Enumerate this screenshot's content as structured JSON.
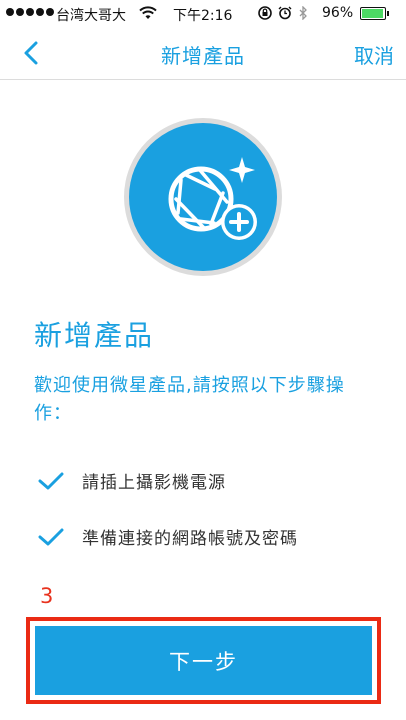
{
  "status_bar": {
    "carrier": "台湾大哥大",
    "time": "下午2:16",
    "battery_percent": "96%",
    "battery_level": 0.96
  },
  "nav": {
    "title": "新增產品",
    "cancel_label": "取消",
    "back_icon": "chevron-left-icon"
  },
  "hero": {
    "icon": "camera-shutter-add-icon",
    "color": "#1aa0e0"
  },
  "content": {
    "heading": "新增產品",
    "intro": "歡迎使用微星產品,請按照以下步驟操作：",
    "steps": [
      {
        "icon": "check-icon",
        "text": "請插上攝影機電源"
      },
      {
        "icon": "check-icon",
        "text": "準備連接的網路帳號及密碼"
      }
    ]
  },
  "annotation": {
    "number": "3",
    "color": "#ea2a14"
  },
  "actions": {
    "next_label": "下一步"
  },
  "colors": {
    "accent": "#1aa0e0",
    "text": "#333333"
  }
}
